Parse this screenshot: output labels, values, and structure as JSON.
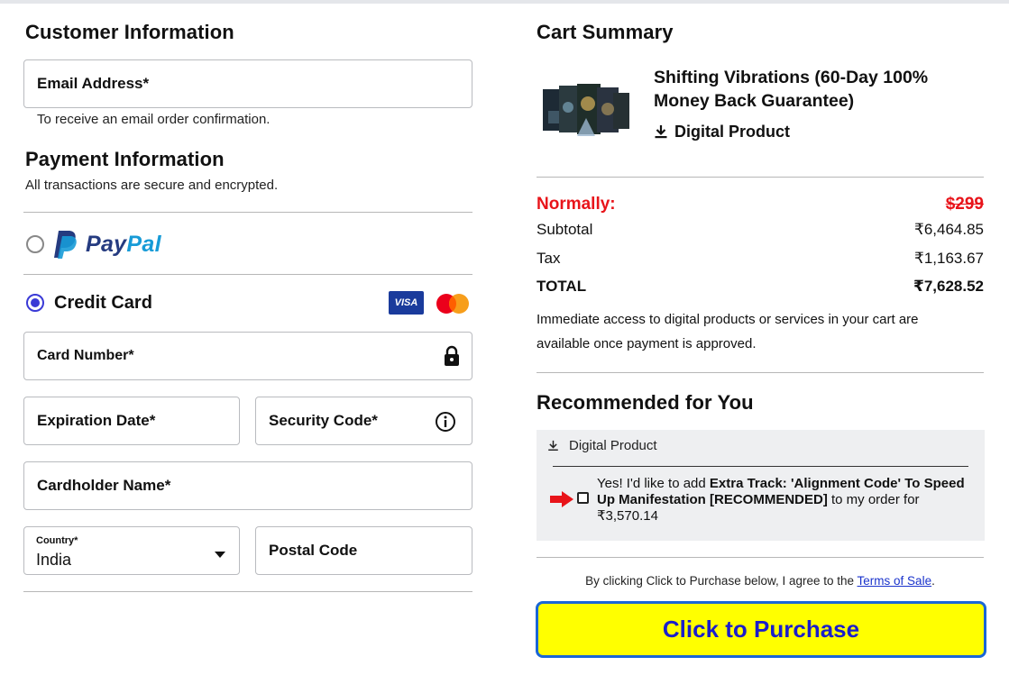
{
  "customer": {
    "heading": "Customer Information",
    "email_label": "Email Address*",
    "email_hint": "To receive an email order confirmation."
  },
  "payment": {
    "heading": "Payment Information",
    "subheading": "All transactions are secure and encrypted.",
    "paypal_label": "PayPal",
    "credit_card_label": "Credit Card",
    "visa_label": "VISA",
    "card_number_label": "Card Number*",
    "expiration_label": "Expiration Date*",
    "security_label": "Security Code*",
    "cardholder_label": "Cardholder Name*",
    "country_label": "Country*",
    "country_value": "India",
    "postal_label": "Postal Code",
    "selected_method": "credit-card"
  },
  "cart": {
    "heading": "Cart Summary",
    "product_title": "Shifting Vibrations (60-Day 100% Money Back Guarantee)",
    "product_type": "Digital Product",
    "normally_label": "Normally:",
    "normally_price": "$299",
    "subtotal_label": "Subtotal",
    "subtotal_value": "₹6,464.85",
    "tax_label": "Tax",
    "tax_value": "₹1,163.67",
    "total_label": "TOTAL",
    "total_value": "₹7,628.52",
    "access_note": "Immediate access to digital products or services in your cart are available once payment is approved."
  },
  "recommended": {
    "heading": "Recommended for You",
    "type_label": "Digital Product",
    "offer_prefix": "Yes! I'd like to add ",
    "offer_bold": "Extra Track: 'Alignment Code' To Speed Up Manifestation [RECOMMENDED]",
    "offer_suffix": " to my order for ₹3,570.14"
  },
  "terms": {
    "prefix": "By clicking Click to Purchase below, I agree to the ",
    "link": "Terms of Sale",
    "suffix": "."
  },
  "purchase_button": "Click to Purchase",
  "colors": {
    "normally_red": "#e8141a",
    "button_yellow": "#ffff00",
    "button_border": "#1a66d6",
    "button_text": "#1b1ecb",
    "radio_selected": "#3a3ad6",
    "visa_blue": "#1a3b9c",
    "paypal_dark": "#253b80",
    "paypal_light": "#179bd7",
    "link_blue": "#1a33cc",
    "arrow_red": "#e8141a"
  }
}
